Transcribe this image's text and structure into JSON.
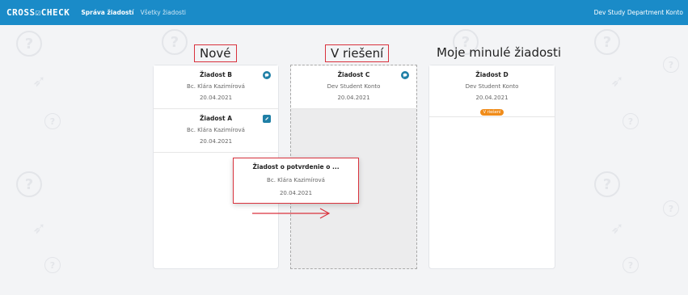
{
  "navbar": {
    "brand": "CROSS☑CHECK",
    "links": [
      {
        "label": "Správa žiadostí",
        "active": true
      },
      {
        "label": "Všetky žiadosti",
        "active": false
      }
    ],
    "user": "Dev Study Department Konto"
  },
  "columns": [
    {
      "heading": "Nové",
      "cards": [
        {
          "title": "Žiadost B",
          "person": "Bc. Klára Kazimírová",
          "date": "20.04.2021",
          "icon": "chat-bubble-icon"
        },
        {
          "title": "Žiadost A",
          "person": "Bc. Klára Kazimírová",
          "date": "20.04.2021",
          "icon": "edit-icon"
        }
      ]
    },
    {
      "heading": "V riešení",
      "cards": [
        {
          "title": "Žiadost C",
          "person": "Dev Student Konto",
          "date": "20.04.2021",
          "icon": "chat-bubble-icon"
        }
      ]
    },
    {
      "heading": "Moje minulé žiadosti",
      "cards": [
        {
          "title": "Žiadost D",
          "person": "Dev Student Konto",
          "date": "20.04.2021",
          "badge": "V riešení"
        }
      ]
    }
  ],
  "dragged_card": {
    "title": "Žiadost o potvrdenie o ...",
    "person": "Bc. Klára Kazimírová",
    "date": "20.04.2021"
  },
  "colors": {
    "navbar": "#1a8bc8",
    "highlight": "#d9323d",
    "icon": "#1f7fa6",
    "badge": "#f08c1a"
  }
}
